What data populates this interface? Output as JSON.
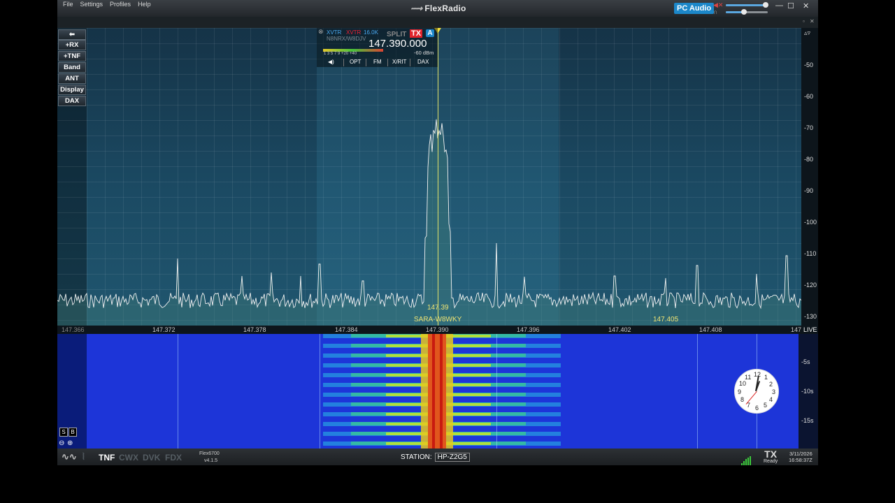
{
  "menu": [
    "File",
    "Settings",
    "Profiles",
    "Help"
  ],
  "brand": "FlexRadio",
  "pc_audio": "PC Audio",
  "window_buttons": [
    "—",
    "☐",
    "✕"
  ],
  "side_buttons": [
    "+RX",
    "+TNF",
    "Band",
    "ANT",
    "Display",
    "DAX"
  ],
  "dbm_scale": [
    "-50",
    "-60",
    "-70",
    "-80",
    "-90",
    "-100",
    "-110",
    "-120",
    "-130"
  ],
  "slice": {
    "xvtr1": "XVTR",
    "xvtr2": "XVTR",
    "bandwidth": "16.0K",
    "callsign": "N8NRX/W8DJV",
    "split": "SPLIT",
    "tx": "TX",
    "letter": "A",
    "frequency": "147.390.000",
    "meter_scale": "1   3   5   7   9  +20 +40",
    "dbm": "-60 dBm",
    "controls": [
      "OPT",
      "FM",
      "X/RIT",
      "DAX"
    ]
  },
  "markers": {
    "center_freq": "147.39",
    "center_name": "SARA-W8WKY",
    "right_freq": "147.405"
  },
  "freq_axis": [
    "147.366",
    "147.372",
    "147.378",
    "147.384",
    "147.390",
    "147.396",
    "147.402",
    "147.408",
    "147"
  ],
  "live": "LIVE",
  "time_scale": [
    "-5s",
    "-10s",
    "-15s"
  ],
  "sb_buttons": [
    "S",
    "B"
  ],
  "status": {
    "tnf": "TNF",
    "cwx": "CWX",
    "dvk": "DVK",
    "fdx": "FDX",
    "model": "Flex6700",
    "version": "v4.1.5",
    "station_label": "STATION:",
    "station_name": "HP-Z2G5",
    "tx": "TX",
    "ready": "Ready",
    "date": "3/11/2026",
    "time": "16:58:37Z"
  },
  "clock_numbers": [
    "12",
    "1",
    "2",
    "3",
    "4",
    "5",
    "6",
    "7",
    "8",
    "9",
    "10",
    "11"
  ]
}
